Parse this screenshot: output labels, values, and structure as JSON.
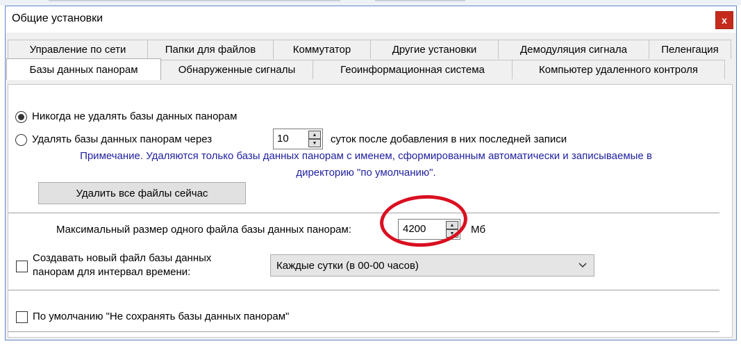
{
  "window": {
    "title": "Общие установки",
    "close_label": "x"
  },
  "tabs_row1": [
    "Управление по сети",
    "Папки для файлов",
    "Коммутатор",
    "Другие установки",
    "Демодуляция сигнала",
    "Пеленгация"
  ],
  "tabs_row2": [
    "Базы данных панорам",
    "Обнаруженные сигналы",
    "Геоинформационная система",
    "Компьютер удаленного контроля"
  ],
  "active_tab": "Базы данных панорам",
  "options": {
    "never_delete_label": "Никогда не удалять базы данных панорам",
    "never_delete_checked": true,
    "delete_after_label": "Удалять базы данных панорам через",
    "delete_after_checked": false,
    "delete_days_value": "10",
    "delete_after_suffix": "суток после добавления в них последней записи",
    "note_line1": "Примечание. Удаляются только базы данных панорам с именем, сформированным автоматически и записываемые в",
    "note_line2": "директорию \"по умолчанию\".",
    "delete_all_button": "Удалить все файлы сейчас"
  },
  "max_size": {
    "label": "Максимальный размер одного файла базы данных панорам:",
    "value": "4200",
    "unit": "Мб"
  },
  "new_file": {
    "label_line1": "Создавать новый файл базы данных",
    "label_line2": "панорам для интервал времени:",
    "checked": false,
    "interval_value": "Каждые сутки (в 00-00 часов)"
  },
  "default_no_save": {
    "label": "По умолчанию \"Не сохранять базы данных панорам\"",
    "checked": false
  },
  "colors": {
    "note_text": "#1f1fa0",
    "highlight_circle": "#d90f20",
    "close_button": "#c42b1c",
    "window_border": "#5f86c7"
  }
}
